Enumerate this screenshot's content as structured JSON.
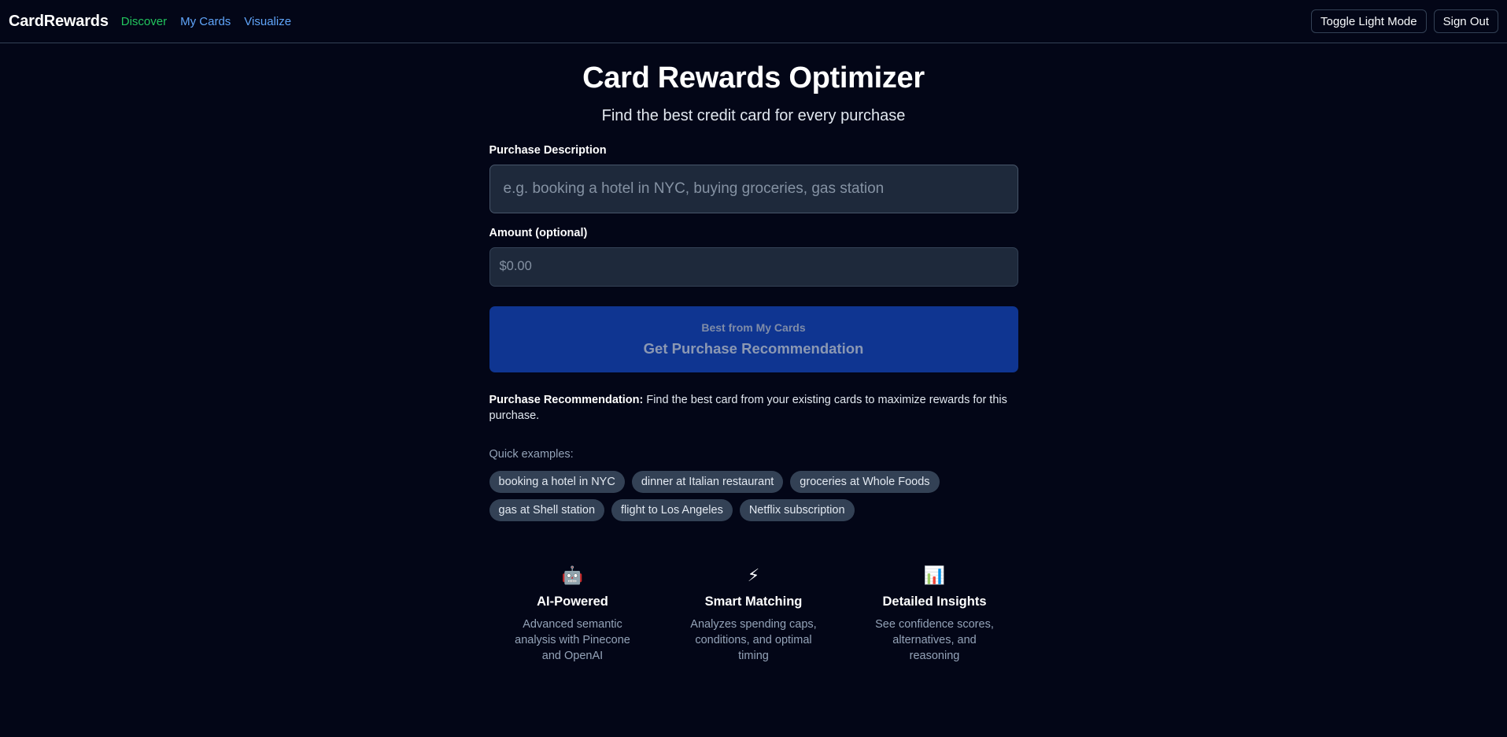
{
  "nav": {
    "brand": "CardRewards",
    "links": [
      {
        "label": "Discover",
        "active": true
      },
      {
        "label": "My Cards",
        "active": false
      },
      {
        "label": "Visualize",
        "active": false
      }
    ],
    "toggle_label": "Toggle Light Mode",
    "signout_label": "Sign Out"
  },
  "hero": {
    "title": "Card Rewards Optimizer",
    "subtitle": "Find the best credit card for every purchase"
  },
  "form": {
    "description_label": "Purchase Description",
    "description_placeholder": "e.g. booking a hotel in NYC, buying groceries, gas station",
    "description_value": "",
    "amount_label": "Amount (optional)",
    "amount_placeholder": "$0.00",
    "amount_value": ""
  },
  "submit": {
    "sublabel": "Best from My Cards",
    "label": "Get Purchase Recommendation"
  },
  "info": {
    "bold": "Purchase Recommendation:",
    "text": " Find the best card from your existing cards to maximize rewards for this purchase."
  },
  "examples": {
    "label": "Quick examples:",
    "items": [
      "booking a hotel in NYC",
      "dinner at Italian restaurant",
      "groceries at Whole Foods",
      "gas at Shell station",
      "flight to Los Angeles",
      "Netflix subscription"
    ]
  },
  "features": [
    {
      "icon": "🤖",
      "icon_name": "robot-icon",
      "title": "AI-Powered",
      "desc": "Advanced semantic analysis with Pinecone and OpenAI"
    },
    {
      "icon": "⚡",
      "icon_name": "lightning-icon",
      "title": "Smart Matching",
      "desc": "Analyzes spending caps, conditions, and optimal timing"
    },
    {
      "icon": "📊",
      "icon_name": "bar-chart-icon",
      "title": "Detailed Insights",
      "desc": "See confidence scores, alternatives, and reasoning"
    }
  ],
  "colors": {
    "background": "#030617",
    "accent_active": "#22c55e",
    "accent_link": "#60a5fa",
    "primary_button": "#0f3591"
  }
}
